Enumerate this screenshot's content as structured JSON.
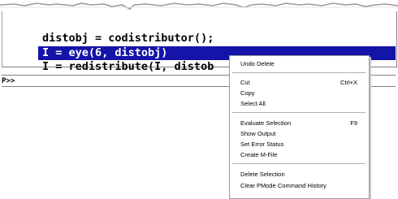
{
  "console": {
    "lines": [
      "distobj = codistributor();",
      "I = eye(6, distobj)",
      "I = redistribute(I, distob"
    ],
    "prompt": "P>>"
  },
  "context_menu": {
    "items": [
      {
        "label": "Undo Delete"
      },
      {
        "label": "Cut",
        "shortcut": "Ctrl+X"
      },
      {
        "label": "Copy"
      },
      {
        "label": "Select All"
      },
      {
        "label": "Evaluate Selection",
        "shortcut": "F9"
      },
      {
        "label": "Show Output"
      },
      {
        "label": "Set Error Status"
      },
      {
        "label": "Create M-File"
      },
      {
        "label": "Delete Selection"
      },
      {
        "label": "Clear PMode Command History"
      }
    ]
  },
  "colors": {
    "selection": "#1414a8"
  }
}
